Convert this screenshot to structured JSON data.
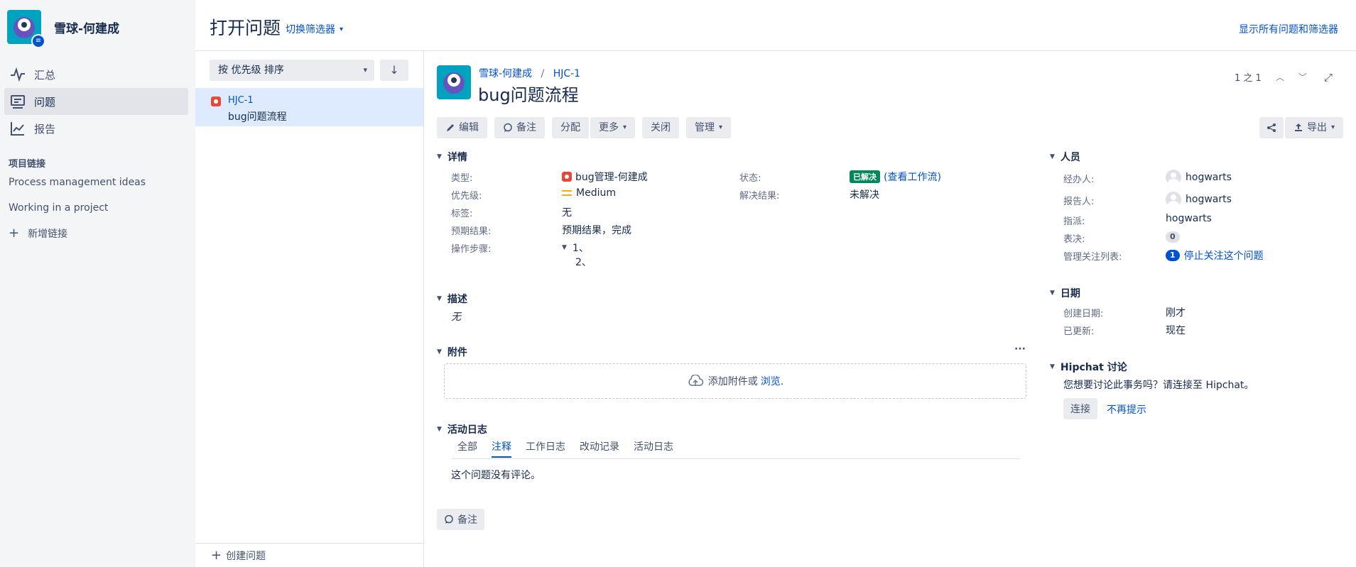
{
  "sidebar": {
    "project_name": "雪球-何建成",
    "nav": [
      {
        "label": "汇总",
        "icon": "pulse-icon"
      },
      {
        "label": "问题",
        "icon": "issues-icon"
      },
      {
        "label": "报告",
        "icon": "chart-icon"
      }
    ],
    "section_label": "项目链接",
    "links": [
      "Process management ideas",
      "Working in a project"
    ],
    "add_link": "新增链接"
  },
  "header": {
    "title": "打开问题",
    "switch_filter": "切换筛选器",
    "show_all": "显示所有问题和筛选器"
  },
  "list": {
    "sort_label": "按 优先级 排序",
    "issue_key": "HJC-1",
    "issue_summary": "bug问题流程",
    "create": "创建问题"
  },
  "detail": {
    "breadcrumb_project": "雪球-何建成",
    "breadcrumb_key": "HJC-1",
    "title": "bug问题流程",
    "pager": "1 之 1",
    "toolbar": {
      "edit": "编辑",
      "comment": "备注",
      "assign": "分配",
      "more": "更多",
      "close": "关闭",
      "admin": "管理",
      "export": "导出"
    },
    "details": {
      "heading": "详情",
      "type_label": "类型:",
      "type_value": "bug管理-何建成",
      "priority_label": "优先级:",
      "priority_value": "Medium",
      "labels_label": "标签:",
      "labels_value": "无",
      "expected_label": "预期结果:",
      "expected_value": "预期结果，完成",
      "steps_label": "操作步骤:",
      "steps": [
        "1、",
        "2、"
      ],
      "status_label": "状态:",
      "status_value": "已解决",
      "workflow_link": "(查看工作流)",
      "resolution_label": "解决结果:",
      "resolution_value": "未解决"
    },
    "description": {
      "heading": "描述",
      "value": "无"
    },
    "attachments": {
      "heading": "附件",
      "drop_text": "添加附件或",
      "browse": "浏览."
    },
    "activity": {
      "heading": "活动日志",
      "tabs": [
        "全部",
        "注释",
        "工作日志",
        "改动记录",
        "活动日志"
      ],
      "active_tab": 1,
      "empty": "这个问题没有评论。",
      "comment_button": "备注"
    },
    "people": {
      "heading": "人员",
      "assignee_label": "经办人:",
      "assignee": "hogwarts",
      "reporter_label": "报告人:",
      "reporter": "hogwarts",
      "assign_label": "指派:",
      "assign_value": "hogwarts",
      "votes_label": "表决:",
      "votes": "0",
      "watchers_label": "管理关注列表:",
      "watchers": "1",
      "unwatch": "停止关注这个问题"
    },
    "dates": {
      "heading": "日期",
      "created_label": "创建日期:",
      "created": "刚才",
      "updated_label": "已更新:",
      "updated": "现在"
    },
    "hipchat": {
      "heading": "Hipchat 讨论",
      "prompt": "您想要讨论此事务吗？请连接至 Hipchat。",
      "connect": "连接",
      "dismiss": "不再提示"
    }
  }
}
